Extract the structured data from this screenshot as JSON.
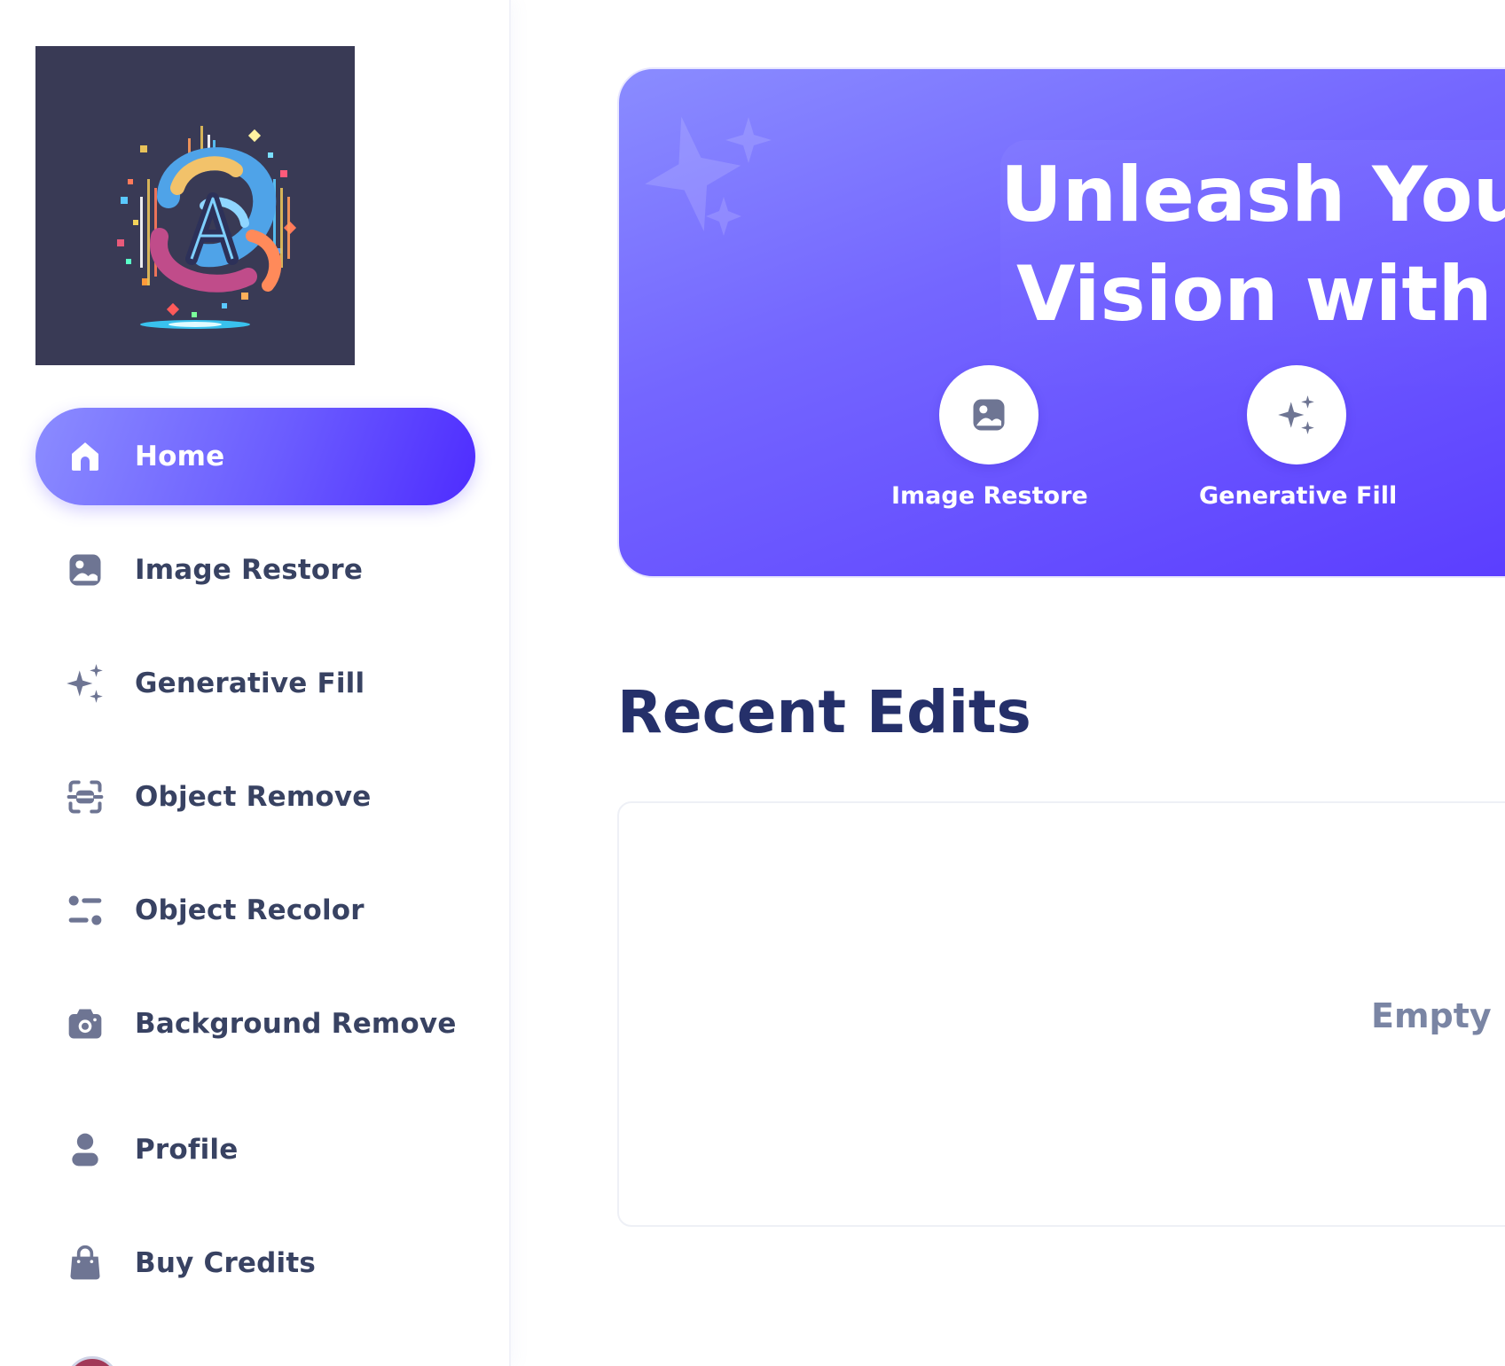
{
  "sidebar": {
    "items": [
      {
        "label": "Home",
        "icon": "home-icon",
        "active": true
      },
      {
        "label": "Image Restore",
        "icon": "image-icon",
        "active": false
      },
      {
        "label": "Generative Fill",
        "icon": "sparkles-icon",
        "active": false
      },
      {
        "label": "Object Remove",
        "icon": "scan-icon",
        "active": false
      },
      {
        "label": "Object Recolor",
        "icon": "filter-icon",
        "active": false
      },
      {
        "label": "Background Remove",
        "icon": "camera-icon",
        "active": false
      },
      {
        "label": "Profile",
        "icon": "user-icon",
        "active": false
      },
      {
        "label": "Buy Credits",
        "icon": "bag-icon",
        "active": false
      }
    ]
  },
  "hero": {
    "title_line1": "Unleash Your",
    "title_line2": "Vision with I",
    "quick_links": [
      {
        "label": "Image Restore",
        "icon": "image-icon"
      },
      {
        "label": "Generative Fill",
        "icon": "sparkles-icon"
      }
    ]
  },
  "recent": {
    "title": "Recent Edits",
    "empty_text": "Empty List"
  },
  "colors": {
    "accent_start": "#8b8cff",
    "accent_end": "#4e2cff",
    "heading": "#25306a",
    "nav_text": "#384262",
    "icon": "#6e7593"
  }
}
